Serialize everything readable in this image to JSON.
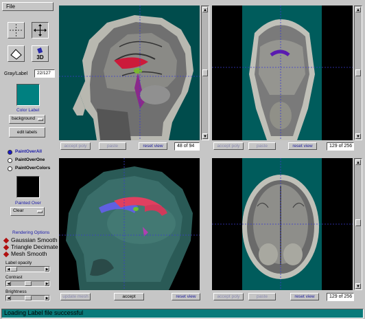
{
  "menu": {
    "file": "File"
  },
  "tools": {
    "threeD": "3D"
  },
  "gray_label": {
    "label": "Gray/Label",
    "value": "22/127"
  },
  "color_label": {
    "title": "Color Label",
    "selected": "background",
    "swatch": "#008080"
  },
  "edit_labels": "edit labels",
  "paint_modes": [
    {
      "label": "PaintOverAll",
      "selected": true
    },
    {
      "label": "PaintOverOne",
      "selected": false
    },
    {
      "label": "PaintOverColors",
      "selected": false
    }
  ],
  "painted_over": {
    "title": "Painted Over",
    "selected": "Clear",
    "swatch": "#000000"
  },
  "rendering": {
    "title": "Rendering Options",
    "options": [
      "Gaussian Smooth",
      "Triangle Decimate",
      "Mesh Smooth"
    ]
  },
  "sliders": {
    "label_opacity": "Label opacity",
    "contrast": "Contrast",
    "brightness": "Brightness"
  },
  "views": {
    "sagittal": {
      "accept": "accept poly",
      "paste": "paste",
      "reset": "reset view",
      "slice": "48 of 94"
    },
    "coronal": {
      "accept": "accept poly",
      "paste": "paste",
      "reset": "reset view",
      "slice": "129 of 256"
    },
    "render3d": {
      "update": "update mesh",
      "accept": "accept",
      "reset": "reset view"
    },
    "axial": {
      "accept": "accept poly",
      "paste": "paste",
      "reset": "reset view",
      "slice": "129 of 256"
    }
  },
  "status": "Loading Label file successful",
  "colors": {
    "teal": "#006868",
    "status_bg": "#0a7a7a",
    "accent_blue": "#1a1aaa"
  }
}
